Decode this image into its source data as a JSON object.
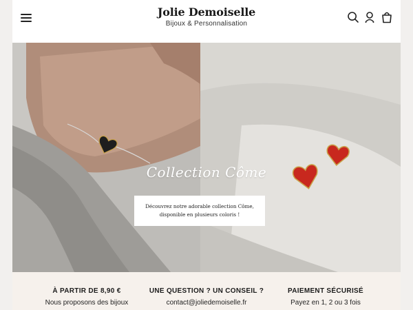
{
  "header": {
    "brand_name": "Jolie Demoiselle",
    "brand_tagline": "Bijoux & Personnalisation",
    "icons": [
      "menu-icon",
      "search-icon",
      "account-icon",
      "cart-icon"
    ]
  },
  "hero": {
    "title": "Collection Côme",
    "promo_line1": "Découvrez notre adorable collection Côme,",
    "promo_line2": "disponible en plusieurs coloris !"
  },
  "reassurance": [
    {
      "title": "À PARTIR DE 8,90 €",
      "text": "Nous proposons des bijoux"
    },
    {
      "title": "UNE QUESTION ? UN CONSEIL ?",
      "text": "contact@joliedemoiselle.fr"
    },
    {
      "title": "PAIEMENT SÉCURISÉ",
      "text": "Payez en 1, 2 ou 3 fois"
    }
  ],
  "colors": {
    "band_bg": "#f6f1ec",
    "heart_red": "#c8281e",
    "heart_black": "#1e1e1e",
    "gold": "#c9a24a"
  }
}
